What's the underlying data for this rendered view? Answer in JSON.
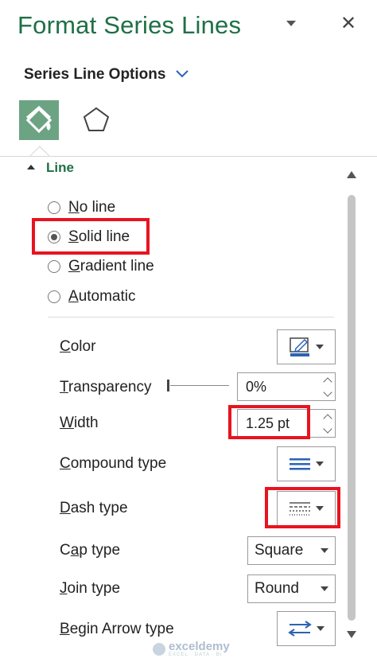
{
  "pane": {
    "title": "Format Series Lines",
    "close_label": "✕"
  },
  "subheader": {
    "label": "Series Line Options"
  },
  "tabs": [
    {
      "name": "fill-and-line",
      "icon": "paint-bucket-icon",
      "active": true
    },
    {
      "name": "effects",
      "icon": "pentagon-icon",
      "active": false
    }
  ],
  "section": {
    "title": "Line"
  },
  "line_options": [
    {
      "access": "N",
      "rest": "o line",
      "selected": false
    },
    {
      "access": "S",
      "rest": "olid line",
      "selected": true
    },
    {
      "access": "G",
      "rest": "radient line",
      "selected": false
    },
    {
      "access": "A",
      "rest": "utomatic",
      "selected": false
    }
  ],
  "properties": {
    "color": {
      "access": "C",
      "rest": "olor"
    },
    "transparency": {
      "access": "T",
      "rest": "ransparency",
      "value": "0%"
    },
    "width": {
      "access": "W",
      "rest": "idth",
      "value": "1.25 pt"
    },
    "compound_type": {
      "access": "C",
      "rest": "ompound type"
    },
    "dash_type": {
      "access": "D",
      "rest": "ash type"
    },
    "cap_type": {
      "access": "a",
      "pre": "C",
      "rest": "p type",
      "value": "Square"
    },
    "join_type": {
      "access": "J",
      "rest": "oin type",
      "value": "Round"
    },
    "begin_arrow_type": {
      "access": "B",
      "rest": "egin Arrow type"
    }
  },
  "colors": {
    "accent_green": "#1e7045",
    "tab_active": "#6ca483",
    "highlight_red": "#e8131f",
    "icon_blue": "#2b63b4"
  },
  "watermark": {
    "name": "exceldemy",
    "tagline": "EXCEL · DATA · BI"
  }
}
